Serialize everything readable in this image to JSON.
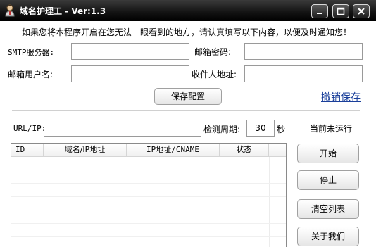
{
  "window": {
    "title": "域名护理工 - Ver:1.3"
  },
  "notice": "如果您将本程序开启在您无法一眼看到的地方，请认真填写以下内容，以便及时通知您！",
  "form": {
    "smtp_label": "SMTP服务器:",
    "smtp_value": "",
    "mailpass_label": "邮箱密码:",
    "mailpass_value": "",
    "mailuser_label": "邮箱用户名:",
    "mailuser_value": "",
    "recipient_label": "收件人地址:",
    "recipient_value": "",
    "save_button": "保存配置",
    "undo_link": "撤销保存"
  },
  "monitor": {
    "url_label": "URL/IP:",
    "url_value": "",
    "interval_label": "检测周期:",
    "interval_value": "30",
    "interval_unit": "秒",
    "status_text": "当前未运行"
  },
  "table": {
    "columns": [
      "ID",
      "域名/IP地址",
      "IP地址/CNAME",
      "状态"
    ],
    "rows": []
  },
  "actions": {
    "start": "开始",
    "stop": "停止",
    "clear": "清空列表",
    "about": "关于我们"
  },
  "colors": {
    "titlebar": "#000000",
    "link": "#1a3f9a"
  }
}
